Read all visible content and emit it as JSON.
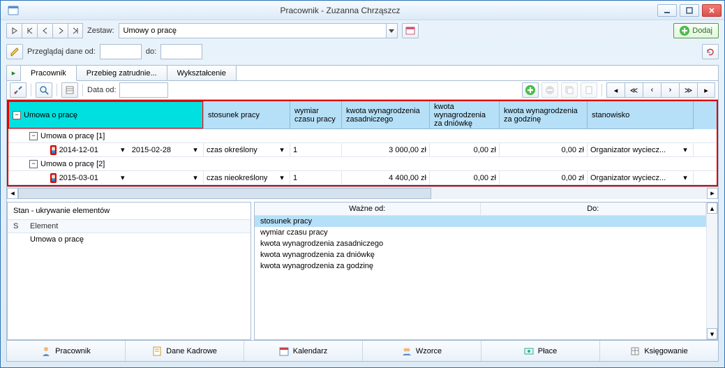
{
  "title": "Pracownik - Zuzanna Chrząszcz",
  "zestaw": {
    "label": "Zestaw:",
    "value": "Umowy o pracę"
  },
  "browse": {
    "label": "Przeglądaj dane od:",
    "to_label": "do:",
    "from": "",
    "to": ""
  },
  "dodaj_label": "Dodaj",
  "inner_tabs": [
    "Pracownik",
    "Przebieg zatrudnie...",
    "Wykształcenie"
  ],
  "gridbar": {
    "data_od_label": "Data od:",
    "data_od": ""
  },
  "columns": {
    "umowa": "Umowa o pracę",
    "stosunek": "stosunek pracy",
    "wymiar": "wymiar czasu pracy",
    "kwota_zas": "kwota wynagrodzenia zasadniczego",
    "kwota_dn": "kwota wynagrodzenia za dniówkę",
    "kwota_godz": "kwota wynagrodzenia za godzinę",
    "stanowisko": "stanowisko"
  },
  "groups": [
    {
      "label": "Umowa o pracę [1]",
      "row": {
        "from": "2014-12-01",
        "to": "2015-02-28",
        "stosunek": "czas określony",
        "wymiar": "1",
        "kwota_zas": "3 000,00 zł",
        "kwota_dn": "0,00 zł",
        "kwota_godz": "0,00 zł",
        "stanowisko": "Organizator wyciecz..."
      }
    },
    {
      "label": "Umowa o pracę [2]",
      "row": {
        "from": "2015-03-01",
        "to": "",
        "stosunek": "czas nieokreślony",
        "wymiar": "1",
        "kwota_zas": "4 400,00 zł",
        "kwota_dn": "0,00 zł",
        "kwota_godz": "0,00 zł",
        "stanowisko": "Organizator wyciecz..."
      }
    }
  ],
  "left_panel": {
    "title": "Stan - ukrywanie elementów",
    "cols": {
      "s": "S",
      "element": "Element"
    },
    "rows": [
      {
        "s": "",
        "element": "Umowa o pracę"
      }
    ]
  },
  "right_panel": {
    "cols": {
      "wazne": "Ważne od:",
      "do": "Do:"
    },
    "items": [
      "stosunek pracy",
      "wymiar czasu pracy",
      "kwota wynagrodzenia zasadniczego",
      "kwota wynagrodzenia za dniówkę",
      "kwota wynagrodzenia za godzinę"
    ],
    "selected_index": 0
  },
  "bottom_nav": [
    "Pracownik",
    "Dane Kadrowe",
    "Kalendarz",
    "Wzorce",
    "Płace",
    "Księgowanie"
  ]
}
